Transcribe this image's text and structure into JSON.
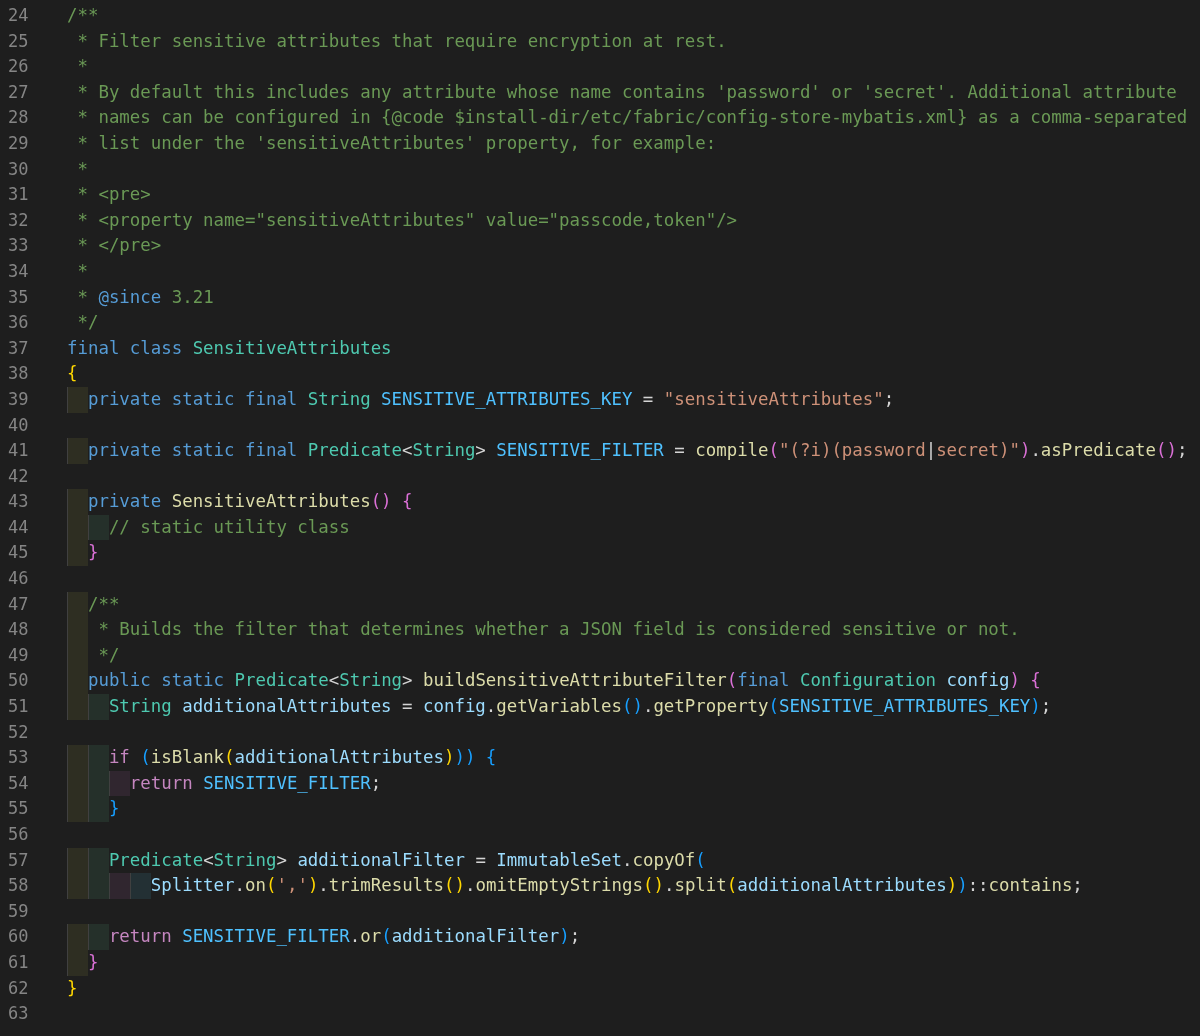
{
  "lines": [
    {
      "number": "24",
      "tokens": [
        {
          "kind": "comment",
          "text": "/**"
        }
      ]
    },
    {
      "number": "25",
      "tokens": [
        {
          "kind": "comment",
          "text": " * Filter sensitive attributes that require encryption at rest."
        }
      ]
    },
    {
      "number": "26",
      "tokens": [
        {
          "kind": "comment",
          "text": " *"
        }
      ]
    },
    {
      "number": "27",
      "tokens": [
        {
          "kind": "comment",
          "text": " * By default this includes any attribute whose name contains 'password' or 'secret'. Additional attribute"
        }
      ]
    },
    {
      "number": "28",
      "tokens": [
        {
          "kind": "comment",
          "text": " * names can be configured in {@code $install-dir/etc/fabric/config-store-mybatis.xml} as a comma-separated"
        }
      ]
    },
    {
      "number": "29",
      "tokens": [
        {
          "kind": "comment",
          "text": " * list under the 'sensitiveAttributes' property, for example:"
        }
      ]
    },
    {
      "number": "30",
      "tokens": [
        {
          "kind": "comment",
          "text": " *"
        }
      ]
    },
    {
      "number": "31",
      "tokens": [
        {
          "kind": "comment",
          "text": " * <pre>"
        }
      ]
    },
    {
      "number": "32",
      "tokens": [
        {
          "kind": "comment",
          "text": " * <property name=\"sensitiveAttributes\" value=\"passcode,token\"/>"
        }
      ]
    },
    {
      "number": "33",
      "tokens": [
        {
          "kind": "comment",
          "text": " * </pre>"
        }
      ]
    },
    {
      "number": "34",
      "tokens": [
        {
          "kind": "comment",
          "text": " *"
        }
      ]
    },
    {
      "number": "35",
      "tokens": [
        {
          "kind": "comment",
          "text": " * "
        },
        {
          "kind": "doctag",
          "text": "@since"
        },
        {
          "kind": "comment",
          "text": " 3.21"
        }
      ]
    },
    {
      "number": "36",
      "tokens": [
        {
          "kind": "comment",
          "text": " */"
        }
      ]
    },
    {
      "number": "37",
      "tokens": [
        {
          "kind": "keyword",
          "text": "final class "
        },
        {
          "kind": "type",
          "text": "SensitiveAttributes"
        }
      ]
    },
    {
      "number": "38",
      "tokens": [
        {
          "kind": "bracket1",
          "text": "{"
        }
      ]
    },
    {
      "number": "39",
      "tokens": [
        {
          "kind": "keyword",
          "text": "  private static final "
        },
        {
          "kind": "type",
          "text": "String "
        },
        {
          "kind": "constant",
          "text": "SENSITIVE_ATTRIBUTES_KEY"
        },
        {
          "kind": "plain",
          "text": " = "
        },
        {
          "kind": "string",
          "text": "\"sensitiveAttributes\""
        },
        {
          "kind": "plain",
          "text": ";"
        }
      ]
    },
    {
      "number": "40"
    },
    {
      "number": "41",
      "tokens": [
        {
          "kind": "keyword",
          "text": "  private static final "
        },
        {
          "kind": "type",
          "text": "Predicate"
        },
        {
          "kind": "plain",
          "text": "<"
        },
        {
          "kind": "type",
          "text": "String"
        },
        {
          "kind": "plain",
          "text": "> "
        },
        {
          "kind": "constant",
          "text": "SENSITIVE_FILTER"
        },
        {
          "kind": "plain",
          "text": " = "
        },
        {
          "kind": "function",
          "text": "compile"
        },
        {
          "kind": "bracket2",
          "text": "("
        },
        {
          "kind": "string",
          "text": "\"(?i)(password"
        },
        {
          "kind": "plain",
          "text": "|"
        },
        {
          "kind": "string",
          "text": "secret)\""
        },
        {
          "kind": "bracket2",
          "text": ")"
        },
        {
          "kind": "plain",
          "text": "."
        },
        {
          "kind": "function",
          "text": "asPredicate"
        },
        {
          "kind": "bracket2",
          "text": "()"
        },
        {
          "kind": "plain",
          "text": ";"
        }
      ]
    },
    {
      "number": "42"
    },
    {
      "number": "43",
      "tokens": [
        {
          "kind": "keyword",
          "text": "  private "
        },
        {
          "kind": "function",
          "text": "SensitiveAttributes"
        },
        {
          "kind": "bracket2",
          "text": "() {"
        }
      ]
    },
    {
      "number": "44",
      "tokens": [
        {
          "kind": "comment",
          "text": "    // static utility class"
        }
      ]
    },
    {
      "number": "45",
      "tokens": [
        {
          "kind": "bracket2",
          "text": "  }"
        }
      ]
    },
    {
      "number": "46"
    },
    {
      "number": "47",
      "tokens": [
        {
          "kind": "comment",
          "text": "  /**"
        }
      ]
    },
    {
      "number": "48",
      "tokens": [
        {
          "kind": "comment",
          "text": "   * Builds the filter that determines whether a JSON field is considered sensitive or not."
        }
      ]
    },
    {
      "number": "49",
      "tokens": [
        {
          "kind": "comment",
          "text": "   */"
        }
      ]
    },
    {
      "number": "50",
      "tokens": [
        {
          "kind": "keyword",
          "text": "  public static "
        },
        {
          "kind": "type",
          "text": "Predicate"
        },
        {
          "kind": "plain",
          "text": "<"
        },
        {
          "kind": "type",
          "text": "String"
        },
        {
          "kind": "plain",
          "text": "> "
        },
        {
          "kind": "function",
          "text": "buildSensitiveAttributeFilter"
        },
        {
          "kind": "bracket2",
          "text": "("
        },
        {
          "kind": "keyword",
          "text": "final "
        },
        {
          "kind": "type",
          "text": "Configuration "
        },
        {
          "kind": "variable",
          "text": "config"
        },
        {
          "kind": "bracket2",
          "text": ") {"
        }
      ]
    },
    {
      "number": "51",
      "tokens": [
        {
          "kind": "type",
          "text": "    String "
        },
        {
          "kind": "variable",
          "text": "additionalAttributes"
        },
        {
          "kind": "plain",
          "text": " = "
        },
        {
          "kind": "variable",
          "text": "config"
        },
        {
          "kind": "plain",
          "text": "."
        },
        {
          "kind": "function",
          "text": "getVariables"
        },
        {
          "kind": "bracket3",
          "text": "()"
        },
        {
          "kind": "plain",
          "text": "."
        },
        {
          "kind": "function",
          "text": "getProperty"
        },
        {
          "kind": "bracket3",
          "text": "("
        },
        {
          "kind": "constant",
          "text": "SENSITIVE_ATTRIBUTES_KEY"
        },
        {
          "kind": "bracket3",
          "text": ")"
        },
        {
          "kind": "plain",
          "text": ";"
        }
      ]
    },
    {
      "number": "52"
    },
    {
      "number": "53",
      "tokens": [
        {
          "kind": "control",
          "text": "    if "
        },
        {
          "kind": "bracket3",
          "text": "("
        },
        {
          "kind": "function",
          "text": "isBlank"
        },
        {
          "kind": "bracket1",
          "text": "("
        },
        {
          "kind": "variable",
          "text": "additionalAttributes"
        },
        {
          "kind": "bracket1",
          "text": ")"
        },
        {
          "kind": "bracket3",
          "text": ")) {"
        }
      ]
    },
    {
      "number": "54",
      "tokens": [
        {
          "kind": "control",
          "text": "      return "
        },
        {
          "kind": "constant",
          "text": "SENSITIVE_FILTER"
        },
        {
          "kind": "plain",
          "text": ";"
        }
      ]
    },
    {
      "number": "55",
      "tokens": [
        {
          "kind": "bracket3",
          "text": "    }"
        }
      ]
    },
    {
      "number": "56"
    },
    {
      "number": "57",
      "tokens": [
        {
          "kind": "type",
          "text": "    Predicate"
        },
        {
          "kind": "plain",
          "text": "<"
        },
        {
          "kind": "type",
          "text": "String"
        },
        {
          "kind": "plain",
          "text": "> "
        },
        {
          "kind": "variable",
          "text": "additionalFilter"
        },
        {
          "kind": "plain",
          "text": " = "
        },
        {
          "kind": "variable",
          "text": "ImmutableSet"
        },
        {
          "kind": "plain",
          "text": "."
        },
        {
          "kind": "function",
          "text": "copyOf"
        },
        {
          "kind": "bracket3",
          "text": "("
        }
      ]
    },
    {
      "number": "58",
      "tokens": [
        {
          "kind": "variable",
          "text": "        Splitter"
        },
        {
          "kind": "plain",
          "text": "."
        },
        {
          "kind": "function",
          "text": "on"
        },
        {
          "kind": "bracket1",
          "text": "("
        },
        {
          "kind": "string",
          "text": "','"
        },
        {
          "kind": "bracket1",
          "text": ")"
        },
        {
          "kind": "plain",
          "text": "."
        },
        {
          "kind": "function",
          "text": "trimResults"
        },
        {
          "kind": "bracket1",
          "text": "()"
        },
        {
          "kind": "plain",
          "text": "."
        },
        {
          "kind": "function",
          "text": "omitEmptyStrings"
        },
        {
          "kind": "bracket1",
          "text": "()"
        },
        {
          "kind": "plain",
          "text": "."
        },
        {
          "kind": "function",
          "text": "split"
        },
        {
          "kind": "bracket1",
          "text": "("
        },
        {
          "kind": "variable",
          "text": "additionalAttributes"
        },
        {
          "kind": "bracket1",
          "text": ")"
        },
        {
          "kind": "bracket3",
          "text": ")"
        },
        {
          "kind": "plain",
          "text": "::"
        },
        {
          "kind": "function",
          "text": "contains"
        },
        {
          "kind": "plain",
          "text": ";"
        }
      ]
    },
    {
      "number": "59"
    },
    {
      "number": "60",
      "tokens": [
        {
          "kind": "control",
          "text": "    return "
        },
        {
          "kind": "constant",
          "text": "SENSITIVE_FILTER"
        },
        {
          "kind": "plain",
          "text": "."
        },
        {
          "kind": "function",
          "text": "or"
        },
        {
          "kind": "bracket3",
          "text": "("
        },
        {
          "kind": "variable",
          "text": "additionalFilter"
        },
        {
          "kind": "bracket3",
          "text": ")"
        },
        {
          "kind": "plain",
          "text": ";"
        }
      ]
    },
    {
      "number": "61",
      "tokens": [
        {
          "kind": "bracket2",
          "text": "  }"
        }
      ]
    },
    {
      "number": "62",
      "tokens": [
        {
          "kind": "bracket1",
          "text": "}"
        }
      ]
    },
    {
      "number": "63"
    }
  ]
}
